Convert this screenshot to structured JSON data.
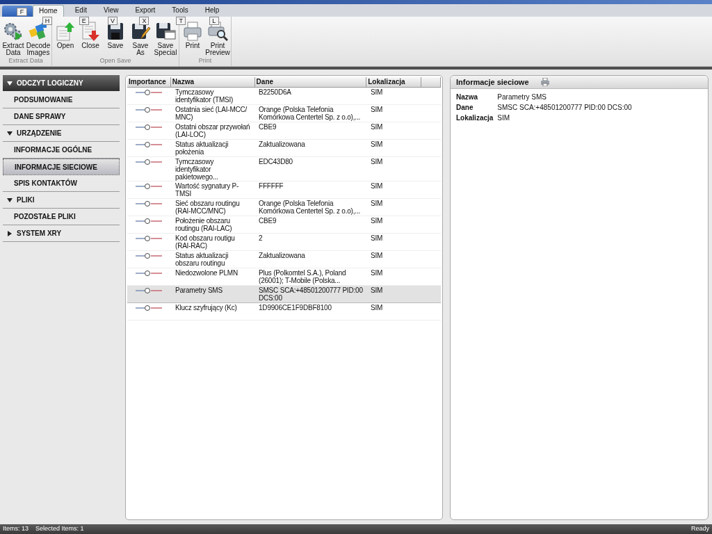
{
  "ribbon": {
    "file_tab": {
      "label": "F"
    },
    "tabs": [
      {
        "label": "Home",
        "key": "H",
        "selected": true
      },
      {
        "label": "Edit",
        "key": "E",
        "selected": false
      },
      {
        "label": "View",
        "key": "V",
        "selected": false
      },
      {
        "label": "Export",
        "key": "X",
        "selected": false
      },
      {
        "label": "Tools",
        "key": "T",
        "selected": false
      },
      {
        "label": "Help",
        "key": "L",
        "selected": false
      }
    ],
    "groups": [
      {
        "title": "Extract Data",
        "buttons": [
          {
            "label": "Extract Data",
            "kind": "gears"
          },
          {
            "label": "Decode Images",
            "kind": "puzzle"
          }
        ]
      },
      {
        "title": "Open Save",
        "buttons": [
          {
            "label": "Open",
            "kind": "open"
          },
          {
            "label": "Close",
            "kind": "close"
          },
          {
            "label": "Save",
            "kind": "save"
          },
          {
            "label": "Save As",
            "kind": "saveas"
          },
          {
            "label": "Save Special",
            "kind": "savespecial"
          }
        ]
      },
      {
        "title": "Print",
        "buttons": [
          {
            "label": "Print",
            "kind": "print"
          },
          {
            "label": "Print Preview",
            "kind": "preview"
          }
        ]
      }
    ]
  },
  "sidebar": {
    "items": [
      {
        "kind": "root",
        "label": "ODCZYT LOGICZNY",
        "expanded": true
      },
      {
        "kind": "item",
        "label": "PODSUMOWANIE",
        "selected": false
      },
      {
        "kind": "item",
        "label": "DANE SPRAWY",
        "selected": false
      },
      {
        "kind": "group",
        "label": "URZĄDZENIE",
        "expanded": true
      },
      {
        "kind": "item",
        "label": "INFORMACJE OGÓLNE",
        "selected": false
      },
      {
        "kind": "item",
        "label": "INFORMACJE SIECIOWE",
        "selected": true
      },
      {
        "kind": "item",
        "label": "SPIS KONTAKTÓW",
        "selected": false
      },
      {
        "kind": "group",
        "label": "PLIKI",
        "expanded": true
      },
      {
        "kind": "item",
        "label": "POZOSTAŁE PLIKI",
        "selected": false
      },
      {
        "kind": "group",
        "label": "SYSTEM XRY",
        "expanded": false
      }
    ]
  },
  "table": {
    "columns": [
      "Importance",
      "Nazwa",
      "Dane",
      "Lokalizacja"
    ],
    "rows": [
      {
        "nazwa": "Tymczasowy identyfikator (TMSI)",
        "dane": "B2250D6A",
        "lokalizacja": "SIM",
        "selected": false
      },
      {
        "nazwa": "Ostatnia sieć (LAI-MCC/ MNC)",
        "dane": "Orange (Polska Telefonia Komórkowa Centertel Sp. z o.o),...",
        "lokalizacja": "SIM",
        "selected": false
      },
      {
        "nazwa": "Ostatni obszar przywołań (LAI-LOC)",
        "dane": "CBE9",
        "lokalizacja": "SIM",
        "selected": false
      },
      {
        "nazwa": "Status aktualizacji położenia",
        "dane": "Zaktualizowana",
        "lokalizacja": "SIM",
        "selected": false
      },
      {
        "nazwa": "Tymczasowy identyfikator pakietowego...",
        "dane": "EDC43D80",
        "lokalizacja": "SIM",
        "selected": false
      },
      {
        "nazwa": "Wartość sygnatury P-TMSI",
        "dane": "FFFFFF",
        "lokalizacja": "SIM",
        "selected": false
      },
      {
        "nazwa": "Sieć obszaru routingu (RAI-MCC/MNC)",
        "dane": "Orange (Polska Telefonia Komórkowa Centertel Sp. z o.o),...",
        "lokalizacja": "SIM",
        "selected": false
      },
      {
        "nazwa": "Położenie obszaru routingu (RAI-LAC)",
        "dane": "CBE9",
        "lokalizacja": "SIM",
        "selected": false
      },
      {
        "nazwa": "Kod obszaru routigu (RAI-RAC)",
        "dane": "2",
        "lokalizacja": "SIM",
        "selected": false
      },
      {
        "nazwa": "Status aktualizacji obszaru routingu",
        "dane": "Zaktualizowana",
        "lokalizacja": "SIM",
        "selected": false
      },
      {
        "nazwa": "Niedozwolone PLMN",
        "dane": "Plus (Polkomtel S.A.), Poland (26001); T-Mobile (Polska...",
        "lokalizacja": "SIM",
        "selected": false
      },
      {
        "nazwa": "Parametry SMS",
        "dane": "SMSC SCA:+48501200777 PID:00 DCS:00",
        "lokalizacja": "SIM",
        "selected": true
      },
      {
        "nazwa": "Klucz szyfrujący (Kc)",
        "dane": "1D9906CE1F9DBF8100",
        "lokalizacja": "SIM",
        "selected": false
      }
    ]
  },
  "details": {
    "title": "Informacje sieciowe",
    "fields": [
      {
        "label": "Nazwa",
        "value": "Parametry SMS"
      },
      {
        "label": "Dane",
        "value": "SMSC SCA:+48501200777 PID:00 DCS:00"
      },
      {
        "label": "Lokalizacja",
        "value": "SIM"
      }
    ]
  },
  "status_bar": {
    "items": "Items: 13",
    "selected": "Selected Items: 1",
    "state": "Ready"
  }
}
